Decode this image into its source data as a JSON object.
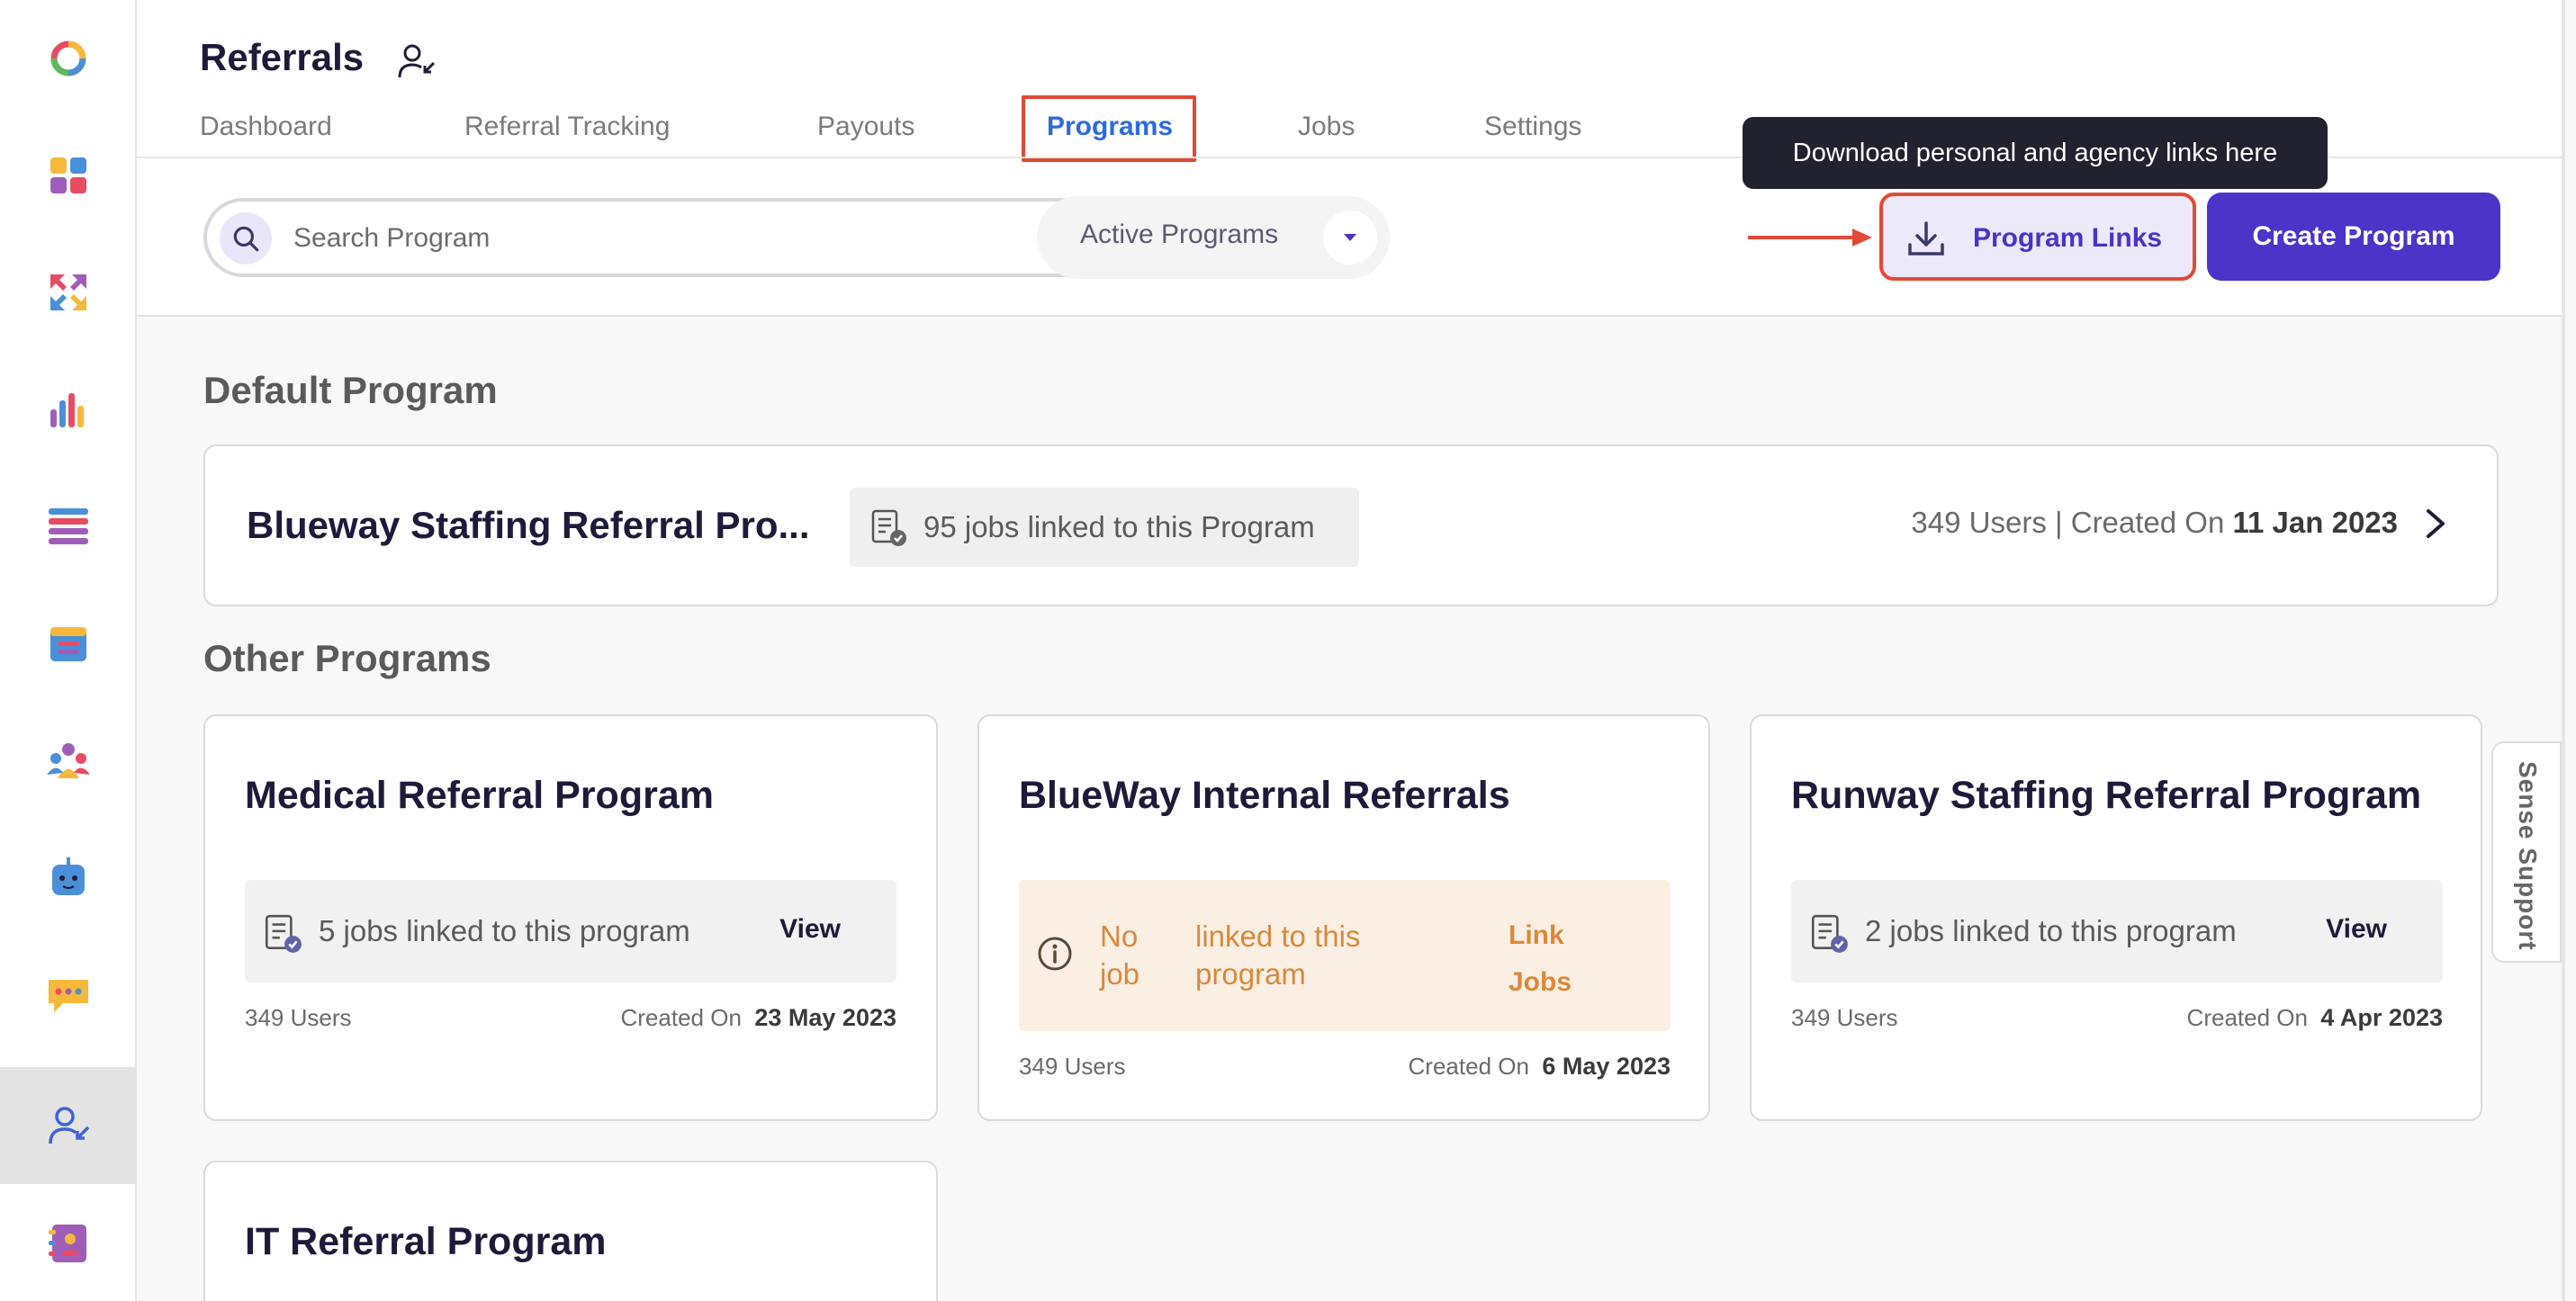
{
  "app": {
    "title": "Referrals",
    "sidebar": {
      "items": [
        {
          "name": "logo-icon",
          "label": "Logo",
          "active": false
        },
        {
          "name": "apps-grid-icon",
          "label": "Apps",
          "active": false
        },
        {
          "name": "arrows-icon",
          "label": "Integrations",
          "active": false
        },
        {
          "name": "analytics-icon",
          "label": "Analytics",
          "active": false
        },
        {
          "name": "list-icon",
          "label": "Lists",
          "active": false
        },
        {
          "name": "calendar-icon",
          "label": "Calendar",
          "active": false
        },
        {
          "name": "people-group-icon",
          "label": "Community",
          "active": false
        },
        {
          "name": "bot-icon",
          "label": "Chatbot",
          "active": false
        },
        {
          "name": "chat-bubble-icon",
          "label": "Messages",
          "active": false
        },
        {
          "name": "referral-user-icon",
          "label": "Referrals",
          "active": true
        },
        {
          "name": "contact-book-icon",
          "label": "Contacts",
          "active": false
        }
      ]
    }
  },
  "header": {
    "tabs": [
      {
        "label": "Dashboard",
        "active": false
      },
      {
        "label": "Referral Tracking",
        "active": false
      },
      {
        "label": "Payouts",
        "active": false
      },
      {
        "label": "Programs",
        "active": true
      },
      {
        "label": "Jobs",
        "active": false
      },
      {
        "label": "Settings",
        "active": false
      }
    ],
    "search": {
      "placeholder": "Search Program",
      "value": ""
    },
    "filter": {
      "selected": "Active Programs"
    },
    "tooltip": "Download personal and agency links here",
    "program_links_label": "Program Links",
    "create_program_label": "Create Program"
  },
  "default_section": {
    "title": "Default Program",
    "program": {
      "name": "Blueway Staffing Referral Pro...",
      "jobs_text": "95 jobs linked to this Program",
      "users_created": "349 Users | Created On",
      "created_date": "11 Jan 2023"
    }
  },
  "other_section": {
    "title": "Other Programs",
    "programs": [
      {
        "name": "Medical Referral Program",
        "jobs_text": "5 jobs linked to this program",
        "action": "View",
        "users": "349 Users",
        "created_label": "Created On",
        "created_date": "23 May 2023"
      },
      {
        "name": "BlueWay Internal Referrals",
        "no_job": "No job",
        "linked_text": "linked to this program",
        "action": "Link Jobs",
        "users": "349 Users",
        "created_label": "Created On",
        "created_date": "6 May 2023"
      },
      {
        "name": "Runway Staffing Referral Program",
        "jobs_text": "2 jobs linked to this program",
        "action": "View",
        "users": "349 Users",
        "created_label": "Created On",
        "created_date": "4 Apr 2023"
      },
      {
        "name": "IT Referral Program"
      }
    ]
  },
  "support": {
    "label": "Sense Support"
  },
  "colors": {
    "accent": "#4d34c8",
    "active_tab": "#2f6bd6",
    "highlight_border": "#e14b35",
    "warning_text": "#d9893c",
    "warning_bg": "#fbefe3"
  }
}
